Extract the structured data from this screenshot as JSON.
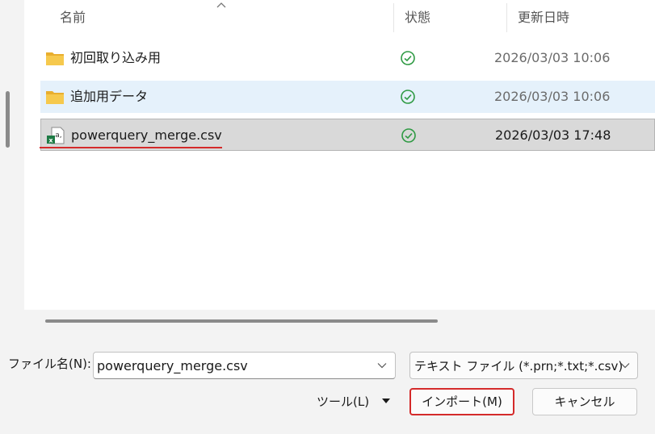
{
  "header": {
    "col_name": "名前",
    "col_status": "状態",
    "col_date": "更新日時"
  },
  "files": [
    {
      "name": "初回取り込み用",
      "type": "folder",
      "status": "synced",
      "date": "2026/03/03 10:06"
    },
    {
      "name": "追加用データ",
      "type": "folder",
      "status": "synced",
      "date": "2026/03/03 10:06"
    },
    {
      "name": "powerquery_merge.csv",
      "type": "csv",
      "status": "synced",
      "date": "2026/03/03 17:48"
    }
  ],
  "footer": {
    "filename_label": "ファイル名(N):",
    "filename_value": "powerquery_merge.csv",
    "filter_value": "テキスト ファイル (*.prn;*.txt;*.csv)",
    "tools_label": "ツール(L)",
    "import_label": "インポート(M)",
    "cancel_label": "キャンセル"
  },
  "colors": {
    "selected_row": "#d9d9d9",
    "hover_row": "#e5f1fb",
    "highlight_red": "#d42a2a",
    "status_green": "#2e9a43",
    "folder_yellow": "#f4c54a"
  }
}
